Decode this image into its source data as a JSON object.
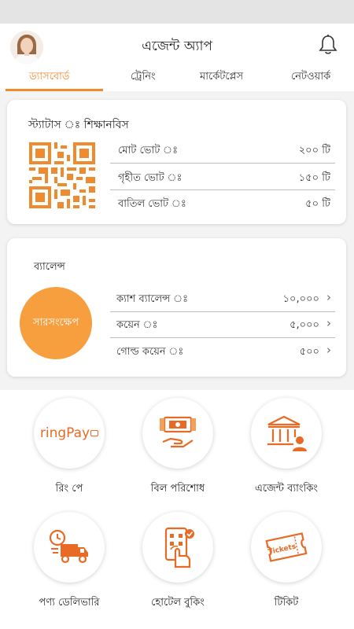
{
  "header": {
    "title": "এজেন্ট অ্যাপ"
  },
  "tabs": [
    {
      "label": "ড্যাসবোর্ড",
      "active": true
    },
    {
      "label": "ট্রেনিং",
      "active": false
    },
    {
      "label": "মার্কেটপ্লেস",
      "active": false
    },
    {
      "label": "নেটওয়ার্ক",
      "active": false
    }
  ],
  "status_card": {
    "status_label": "স্ট্যাটাস ঃ শিক্ষানবিস",
    "rows": [
      {
        "label": "মোট ভোট ঃ",
        "value": "২০০ টি"
      },
      {
        "label": "গৃহীত ভোট ঃ",
        "value": "১৫০ টি"
      },
      {
        "label": "বাতিল ভোট ঃ",
        "value": "৫০ টি"
      }
    ]
  },
  "balance_card": {
    "title": "ব্যালেন্স",
    "summary_button": "সারসংক্ষেপ",
    "rows": [
      {
        "label": "ক্যাশ ব্যালেন্স ঃ",
        "value": "১০,০০০"
      },
      {
        "label": "কয়েন ঃ",
        "value": "৫,০০০"
      },
      {
        "label": "গোল্ড কয়েন ঃ",
        "value": "৫০০"
      }
    ]
  },
  "services": [
    {
      "label": "রিং পে",
      "icon": "ringpay-logo"
    },
    {
      "label": "বিল পরিশোধ",
      "icon": "bill-payment-icon"
    },
    {
      "label": "এজেন্ট ব্যাংকিং",
      "icon": "bank-icon"
    },
    {
      "label": "পণ্য ডেলিভারি",
      "icon": "delivery-truck-icon"
    },
    {
      "label": "হোটেল বুকিং",
      "icon": "hotel-booking-icon"
    },
    {
      "label": "টিকিট",
      "icon": "ticket-icon"
    }
  ],
  "ringpay_logo_text": "ringPay",
  "ticket_icon_text": "Tickets",
  "colors": {
    "accent": "#f28a2c",
    "summary_button": "#f79e3e",
    "panel_bg": "#f3f3f3"
  }
}
